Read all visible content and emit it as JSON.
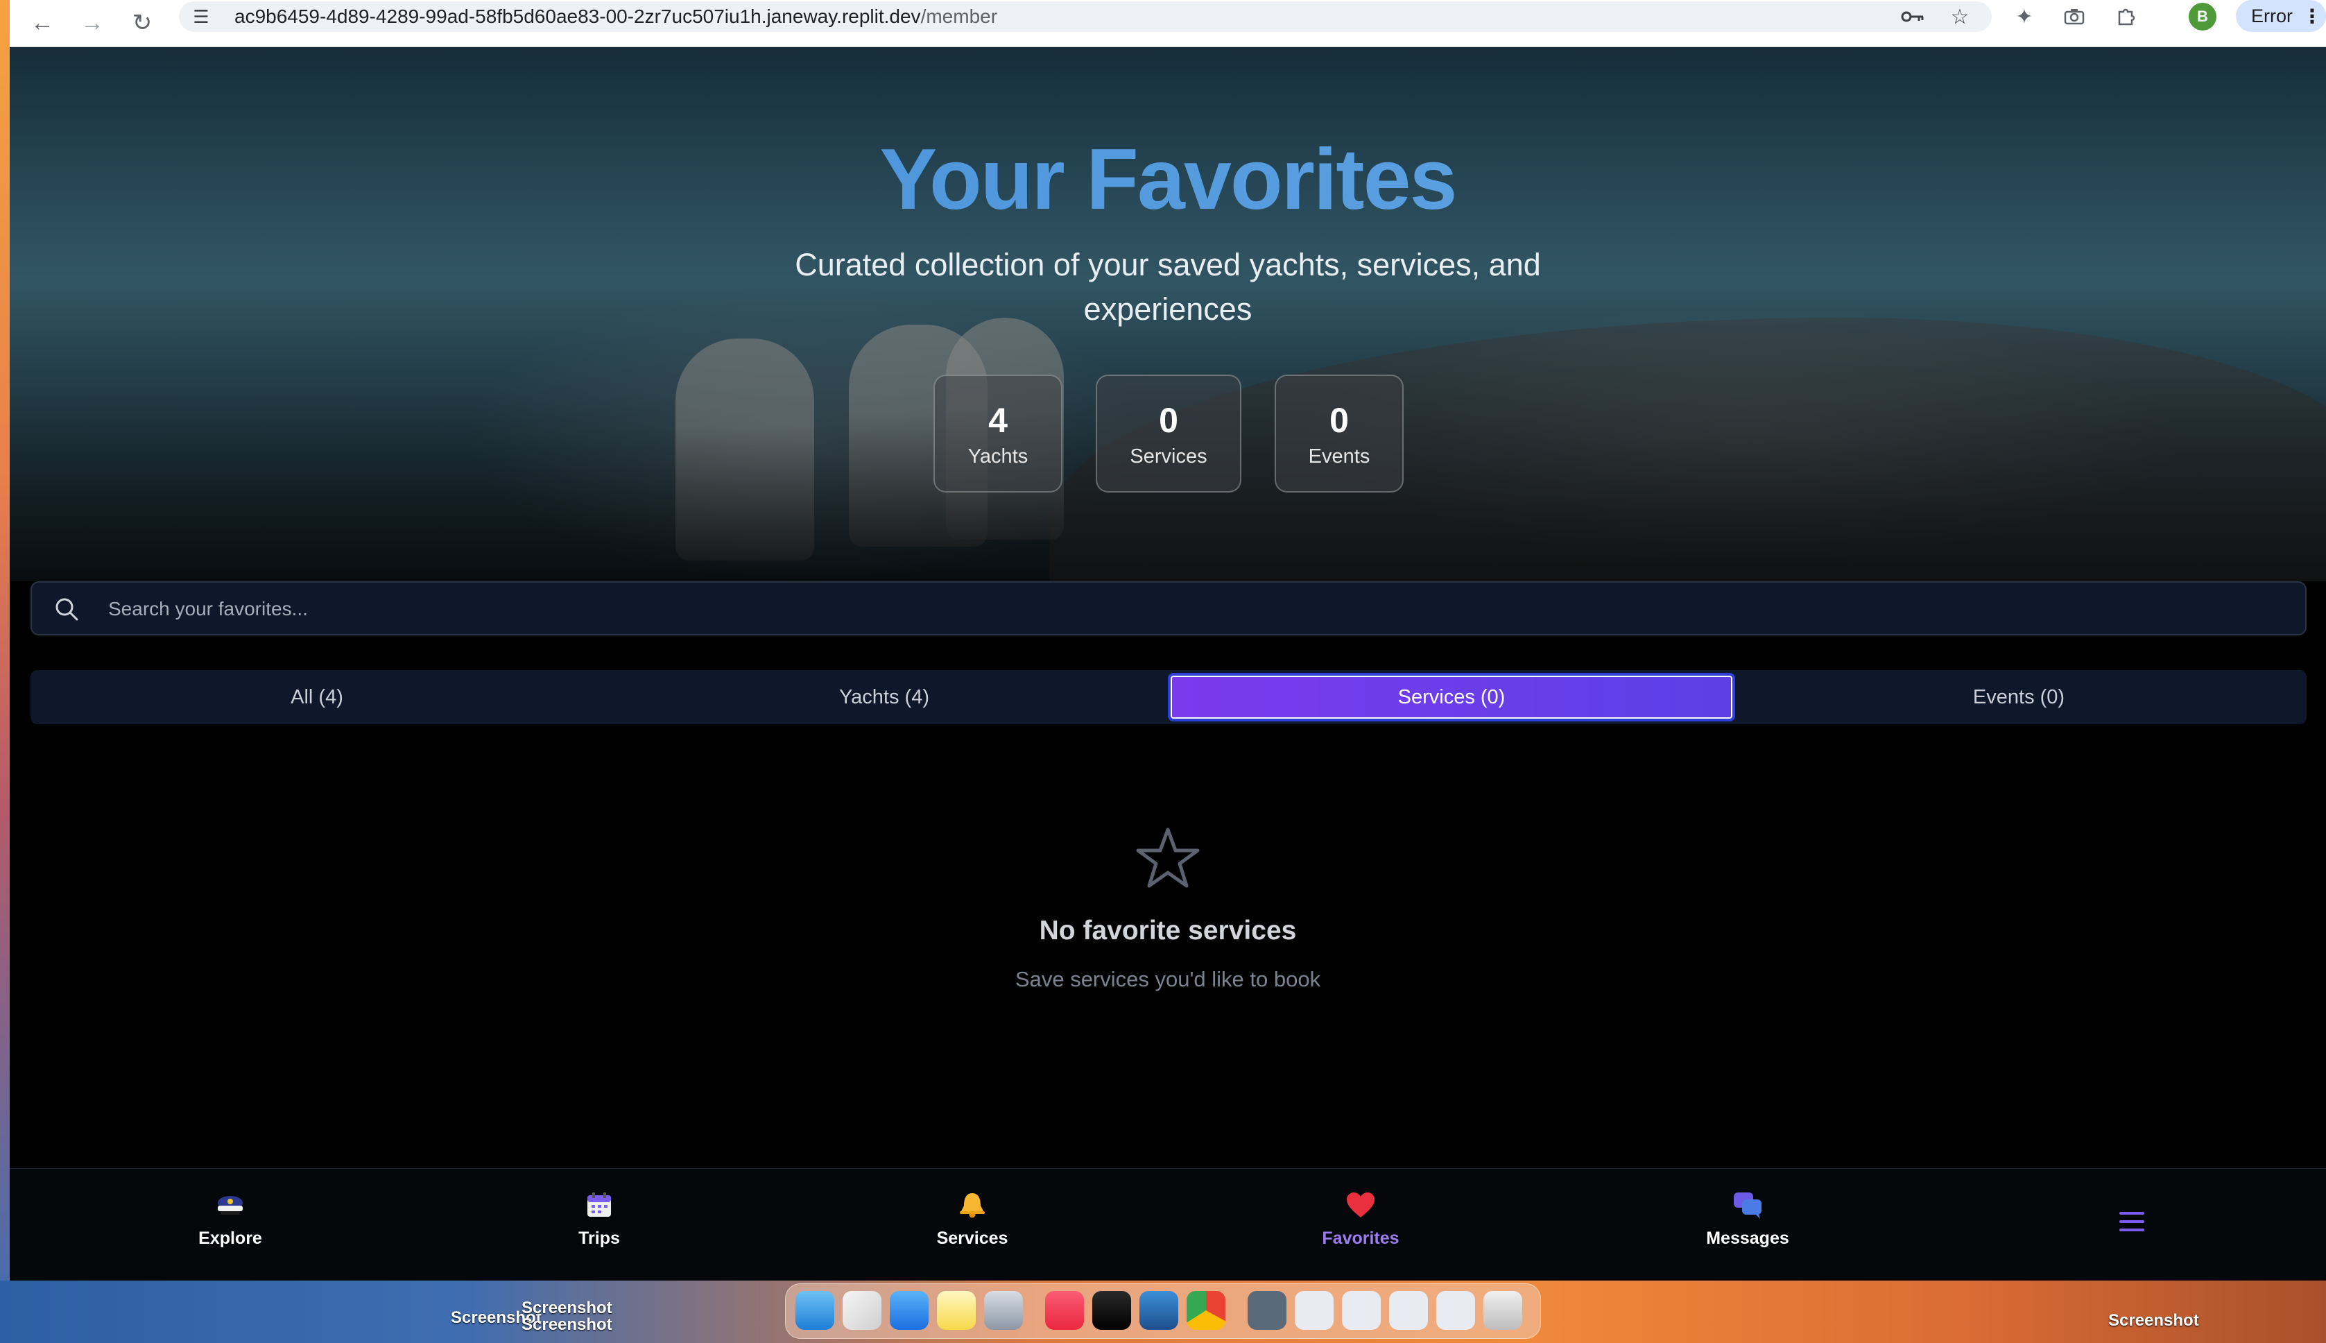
{
  "browser": {
    "url_host": "ac9b6459-4d89-4289-99ad-58fb5d60ae83-00-2zr7uc507iu1h.janeway.replit.dev",
    "url_path": "/member",
    "profile_initial": "B",
    "error_label": "Error",
    "icons": [
      "back-arrow-icon",
      "forward-arrow-icon",
      "reload-icon",
      "site-info-icon",
      "password-key-icon",
      "bookmark-star-icon",
      "extension-icon",
      "camera-icon",
      "puzzle-icon",
      "kebab-menu-icon"
    ]
  },
  "hero": {
    "title": "Your Favorites",
    "subtitle": "Curated collection of your saved yachts, services, and experiences",
    "stats": [
      {
        "value": "4",
        "label": "Yachts"
      },
      {
        "value": "0",
        "label": "Services"
      },
      {
        "value": "0",
        "label": "Events"
      }
    ]
  },
  "search": {
    "placeholder": "Search your favorites..."
  },
  "tabs": [
    {
      "label": "All (4)",
      "active": false
    },
    {
      "label": "Yachts (4)",
      "active": false
    },
    {
      "label": "Services (0)",
      "active": true
    },
    {
      "label": "Events (0)",
      "active": false
    }
  ],
  "empty_state": {
    "icon": "star-outline-icon",
    "title": "No favorite services",
    "subtitle": "Save services you'd like to book"
  },
  "bottom_nav": {
    "items": [
      {
        "label": "Explore",
        "icon": "captain-hat-icon",
        "active": false
      },
      {
        "label": "Trips",
        "icon": "calendar-icon",
        "active": false
      },
      {
        "label": "Services",
        "icon": "bell-icon",
        "active": false
      },
      {
        "label": "Favorites",
        "icon": "heart-icon",
        "active": true
      },
      {
        "label": "Messages",
        "icon": "chat-bubbles-icon",
        "active": false
      }
    ],
    "menu_icon": "hamburger-menu-icon"
  },
  "desktop": {
    "labels": [
      "Screenshot",
      "Screenshot",
      "Screenshot",
      "Screenshot"
    ]
  },
  "colors": {
    "accent_purple": "#7c3aed",
    "title_blue": "#3f88d6",
    "active_nav": "#9b7cf2"
  }
}
